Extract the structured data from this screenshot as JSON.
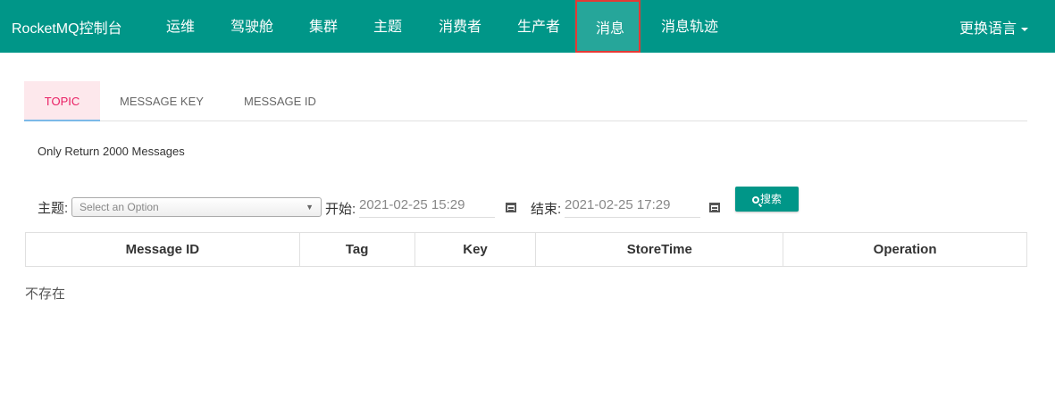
{
  "navbar": {
    "brand": "RocketMQ控制台",
    "items": [
      {
        "label": "运维"
      },
      {
        "label": "驾驶舱"
      },
      {
        "label": "集群"
      },
      {
        "label": "主题"
      },
      {
        "label": "消费者"
      },
      {
        "label": "生产者"
      },
      {
        "label": "消息",
        "active": true
      },
      {
        "label": "消息轨迹"
      }
    ],
    "language_label": "更换语言",
    "bg_color": "#009688",
    "highlight_color": "#e53935"
  },
  "tabs": [
    {
      "label": "TOPIC",
      "active": true
    },
    {
      "label": "MESSAGE KEY"
    },
    {
      "label": "MESSAGE ID"
    }
  ],
  "note": "Only Return 2000 Messages",
  "filters": {
    "topic_label": "主题:",
    "topic_placeholder": "Select an Option",
    "start_label": "开始:",
    "start_value": "2021-02-25 15:29",
    "end_label": "结束:",
    "end_value": "2021-02-25 17:29",
    "search_label": "搜索"
  },
  "table": {
    "columns": [
      "Message ID",
      "Tag",
      "Key",
      "StoreTime",
      "Operation"
    ]
  },
  "empty_text": "不存在"
}
